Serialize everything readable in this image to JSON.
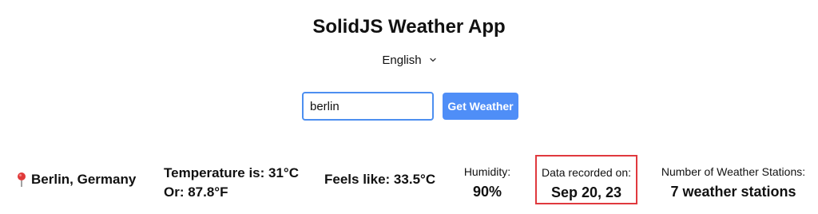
{
  "app": {
    "title": "SolidJS Weather App"
  },
  "language_select": {
    "selected": "English",
    "icon": "chevron-down-icon"
  },
  "search": {
    "value": "berlin",
    "button_label": "Get Weather"
  },
  "weather": {
    "location_icon": "pin-icon",
    "location": "Berlin, Germany",
    "temperature_c": "Temperature is: 31°C",
    "temperature_f": "Or: 87.8°F",
    "feels_like": "Feels like: 33.5°C",
    "humidity_label": "Humidity:",
    "humidity_value": "90%",
    "recorded_label": "Data recorded on:",
    "recorded_value": "Sep 20, 23",
    "stations_label": "Number of Weather Stations:",
    "stations_value": "7 weather stations"
  },
  "colors": {
    "accent": "#4f8ef7",
    "highlight_border": "#e0393e",
    "pin": "#e03a3a"
  }
}
